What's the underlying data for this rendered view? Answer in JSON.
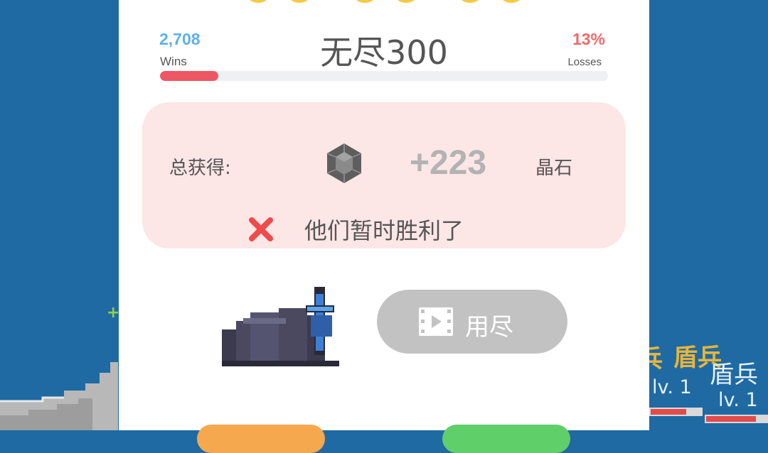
{
  "header": {
    "title": "无尽300",
    "wins_value": "2,708",
    "wins_label": "Wins",
    "losses_value": "13%",
    "losses_label": "Losses",
    "loss_rate_fraction": 0.13
  },
  "reward": {
    "total_label": "总获得:",
    "gem_icon": "crystal-gem-icon",
    "amount": "+223",
    "unit": "晶石"
  },
  "result": {
    "icon": "red-x-icon",
    "message": "他们暂时胜利了"
  },
  "video_button": {
    "icon": "film-play-icon",
    "label": "用尽"
  },
  "background": {
    "right_labels": [
      {
        "text": "盾兵"
      },
      {
        "text": "盾兵"
      },
      {
        "text": "lv. 1"
      },
      {
        "text": "lv. 1"
      }
    ],
    "partial_label": "兵",
    "plus_mark": "+"
  },
  "colors": {
    "sea": "#1f6aa3",
    "wins": "#5fb1ea",
    "losses": "#ef6a6a",
    "panel": "#fde6e6",
    "button_disabled": "#c2c2c2"
  }
}
